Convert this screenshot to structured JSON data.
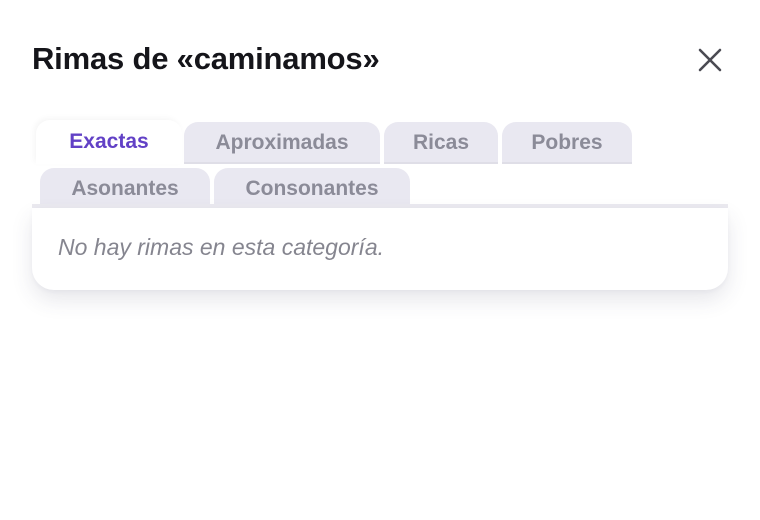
{
  "dialog": {
    "title": "Rimas de «caminamos»",
    "close_icon": "close-x-icon"
  },
  "tabs": [
    {
      "id": "exactas",
      "label": "Exactas",
      "active": true
    },
    {
      "id": "aproximadas",
      "label": "Aproximadas",
      "active": false
    },
    {
      "id": "ricas",
      "label": "Ricas",
      "active": false
    },
    {
      "id": "pobres",
      "label": "Pobres",
      "active": false
    },
    {
      "id": "asonantes",
      "label": "Asonantes",
      "active": false
    },
    {
      "id": "consonantes",
      "label": "Consonantes",
      "active": false
    }
  ],
  "content": {
    "empty_message": "No hay rimas en esta categoría."
  },
  "colors": {
    "accent": "#6241c6",
    "tab_inactive_bg": "#e9e8f1",
    "tab_inactive_text": "#8b8b98",
    "title_text": "#15151a",
    "muted_text": "#85858f"
  }
}
